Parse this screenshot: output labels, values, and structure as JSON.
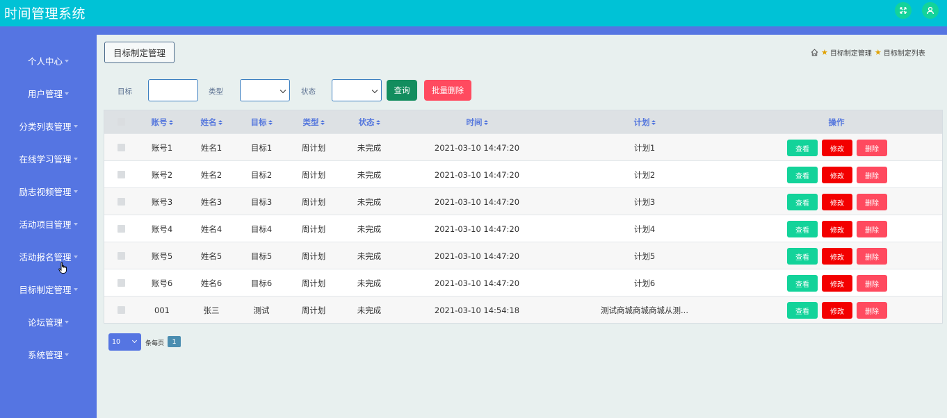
{
  "header": {
    "app_title": "时间管理系统",
    "icons": [
      "fullscreen-icon",
      "user-icon"
    ],
    "colors": {
      "topbar": "#00c2d6",
      "sidebar": "#5575e2",
      "icon_bg": "#13d39a"
    }
  },
  "sidebar": {
    "items": [
      {
        "label": "个人中心"
      },
      {
        "label": "用户管理"
      },
      {
        "label": "分类列表管理"
      },
      {
        "label": "在线学习管理"
      },
      {
        "label": "励志视频管理"
      },
      {
        "label": "活动项目管理"
      },
      {
        "label": "活动报名管理"
      },
      {
        "label": "目标制定管理"
      },
      {
        "label": "论坛管理"
      },
      {
        "label": "系统管理"
      }
    ]
  },
  "page": {
    "section_button": "目标制定管理",
    "breadcrumb": [
      "目标制定管理",
      "目标制定列表"
    ]
  },
  "filters": {
    "target_label": "目标",
    "target_value": "",
    "type_label": "类型",
    "type_value": "",
    "status_label": "状态",
    "status_value": "",
    "query_button": "查询",
    "batch_delete_button": "批量删除"
  },
  "table": {
    "columns": [
      "账号",
      "姓名",
      "目标",
      "类型",
      "状态",
      "时间",
      "计划",
      "操作"
    ],
    "rows": [
      {
        "account": "账号1",
        "name": "姓名1",
        "target": "目标1",
        "type": "周计划",
        "status": "未完成",
        "time": "2021-03-10 14:47:20",
        "plan": "计划1"
      },
      {
        "account": "账号2",
        "name": "姓名2",
        "target": "目标2",
        "type": "周计划",
        "status": "未完成",
        "time": "2021-03-10 14:47:20",
        "plan": "计划2"
      },
      {
        "account": "账号3",
        "name": "姓名3",
        "target": "目标3",
        "type": "周计划",
        "status": "未完成",
        "time": "2021-03-10 14:47:20",
        "plan": "计划3"
      },
      {
        "account": "账号4",
        "name": "姓名4",
        "target": "目标4",
        "type": "周计划",
        "status": "未完成",
        "time": "2021-03-10 14:47:20",
        "plan": "计划4"
      },
      {
        "account": "账号5",
        "name": "姓名5",
        "target": "目标5",
        "type": "周计划",
        "status": "未完成",
        "time": "2021-03-10 14:47:20",
        "plan": "计划5"
      },
      {
        "account": "账号6",
        "name": "姓名6",
        "target": "目标6",
        "type": "周计划",
        "status": "未完成",
        "time": "2021-03-10 14:47:20",
        "plan": "计划6"
      },
      {
        "account": "001",
        "name": "张三",
        "target": "测试",
        "type": "周计划",
        "status": "未完成",
        "time": "2021-03-10 14:54:18",
        "plan": "测试商城商城商城从测..."
      }
    ],
    "actions": {
      "view": "查看",
      "edit": "修改",
      "delete": "删除"
    }
  },
  "pagination": {
    "page_size": "10",
    "per_page_label": "条每页",
    "current_page": "1"
  }
}
